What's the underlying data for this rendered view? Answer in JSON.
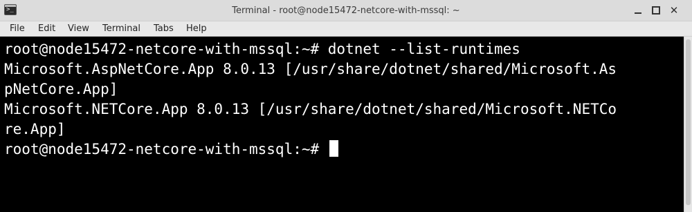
{
  "window": {
    "title": "Terminal - root@node15472-netcore-with-mssql: ~",
    "app_icon_glyph": ">_",
    "buttons": {
      "minimize": "minimize-icon",
      "maximize": "maximize-icon",
      "close": "✕"
    }
  },
  "menubar": {
    "items": [
      {
        "label": "File"
      },
      {
        "label": "Edit"
      },
      {
        "label": "View"
      },
      {
        "label": "Terminal"
      },
      {
        "label": "Tabs"
      },
      {
        "label": "Help"
      }
    ]
  },
  "terminal": {
    "lines": [
      "root@node15472-netcore-with-mssql:~# dotnet --list-runtimes",
      "Microsoft.AspNetCore.App 8.0.13 [/usr/share/dotnet/shared/Microsoft.As",
      "pNetCore.App]",
      "Microsoft.NETCore.App 8.0.13 [/usr/share/dotnet/shared/Microsoft.NETCo",
      "re.App]",
      "root@node15472-netcore-with-mssql:~# "
    ]
  },
  "colors": {
    "terminal_bg": "#000000",
    "terminal_fg": "#ffffff",
    "titlebar_bg": "#dcdcdc",
    "menubar_bg": "#e8e8e8"
  }
}
